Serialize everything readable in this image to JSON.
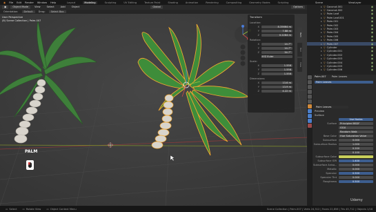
{
  "menubar": {
    "menus": [
      "File",
      "Edit",
      "Render",
      "Window",
      "Help"
    ],
    "workspace_tabs": [
      "Layout",
      "Modeling",
      "Sculpting",
      "UV Editing",
      "Texture Paint",
      "Shading",
      "Animation",
      "Rendering",
      "Compositing",
      "Geometry Nodes",
      "Scripting"
    ],
    "active_tab": "Modeling",
    "scene": "Scene",
    "view_layer": "ViewLayer"
  },
  "header": {
    "mode": "Object Mode",
    "view": "View",
    "select": "Select",
    "add": "Add",
    "object": "Object",
    "orientation": "Global",
    "options": "Options"
  },
  "header3": {
    "orientation_label": "Orientation:",
    "orientation_value": "Default",
    "drag": "Drag:",
    "drag_value": "Select Box"
  },
  "viewport": {
    "perspective": "User Perspective",
    "collection": "(8) Scene Collection | Palm.007",
    "palm_label": "PALM"
  },
  "transform": {
    "title": "Transform",
    "location_label": "Location:",
    "location": {
      "x": "8.35664 m",
      "y": "7.88 m",
      "z": "0.2284 m"
    },
    "rotation_label": "Rotation:",
    "rotation": {
      "x": "14.7°",
      "y": "14.7°",
      "z": "34.7°"
    },
    "rotation_mode": "XYZ Euler",
    "scale_label": "Scale:",
    "scale": {
      "x": "1.556",
      "y": "1.556",
      "z": "1.556"
    },
    "dimensions_label": "Dimensions:",
    "dimensions": {
      "x": "13.6 m",
      "y": "13.9 m",
      "z": "4.22 m"
    }
  },
  "ntabs": [
    "Item",
    "Tool",
    "View"
  ],
  "outliner": {
    "rows": [
      {
        "name": "Coconut.001",
        "selected": false
      },
      {
        "name": "Coconut.002",
        "selected": false
      },
      {
        "name": "Palm Leaf",
        "selected": false
      },
      {
        "name": "Palm Leaf.001",
        "selected": false
      },
      {
        "name": "Palm.001",
        "selected": false
      },
      {
        "name": "Palm.002",
        "selected": false
      },
      {
        "name": "Palm.003",
        "selected": false
      },
      {
        "name": "Palm.004",
        "selected": false
      },
      {
        "name": "Palm.005",
        "selected": false
      },
      {
        "name": "Palm.006",
        "selected": false
      },
      {
        "name": "Palm.007",
        "selected": true
      },
      {
        "name": "Cylinder",
        "selected": false
      },
      {
        "name": "Cylinder.001",
        "selected": false
      },
      {
        "name": "Cylinder.002",
        "selected": false
      },
      {
        "name": "Cylinder.003",
        "selected": false
      },
      {
        "name": "Cylinder.004",
        "selected": false
      },
      {
        "name": "Cylinder.005",
        "selected": false
      },
      {
        "name": "Cylinder.006",
        "selected": false
      }
    ]
  },
  "properties": {
    "object": "Palm.007",
    "material_slot": "Palm Leaves",
    "material": "Palm Leaves",
    "preview": "Preview",
    "surface_section": "Surface",
    "use_nodes": "Use Nodes",
    "surface": "Principled BSDF",
    "distribution": "GGX",
    "subsurface_method": "Random Walk",
    "base_color_label": "Base Color",
    "base_color_value": "Hue Saturation Value",
    "rows": [
      {
        "label": "Subsurface",
        "value": "0.000"
      },
      {
        "label": "Subsurface Radius",
        "value": "1.000"
      },
      {
        "label": "",
        "value": "0.200"
      },
      {
        "label": "",
        "value": "0.100"
      },
      {
        "label": "Subsurface Color",
        "value": ""
      },
      {
        "label": "Subsurface IOR",
        "value": "1.400"
      },
      {
        "label": "Subsurface Aniso...",
        "value": "0.000"
      },
      {
        "label": "Metallic",
        "value": "0.000"
      },
      {
        "label": "Specular",
        "value": "0.500"
      },
      {
        "label": "Specular Tint",
        "value": "0.000"
      },
      {
        "label": "Roughness",
        "value": "0.500"
      }
    ]
  },
  "status": {
    "select": "Select",
    "rotate": "Rotate View",
    "context": "Object Context Menu",
    "stats": "Scene Collection | Palm.007 | Verts 24,312 | Faces 22,856 | Tris 45,712 | Objects 1/18"
  },
  "watermark": "Udemy",
  "colors": {
    "accent": "#4772b3",
    "leaf": "#3e8d3a",
    "leaf_selected_outline": "#f0a530",
    "trunk": "#d9d5cc"
  }
}
